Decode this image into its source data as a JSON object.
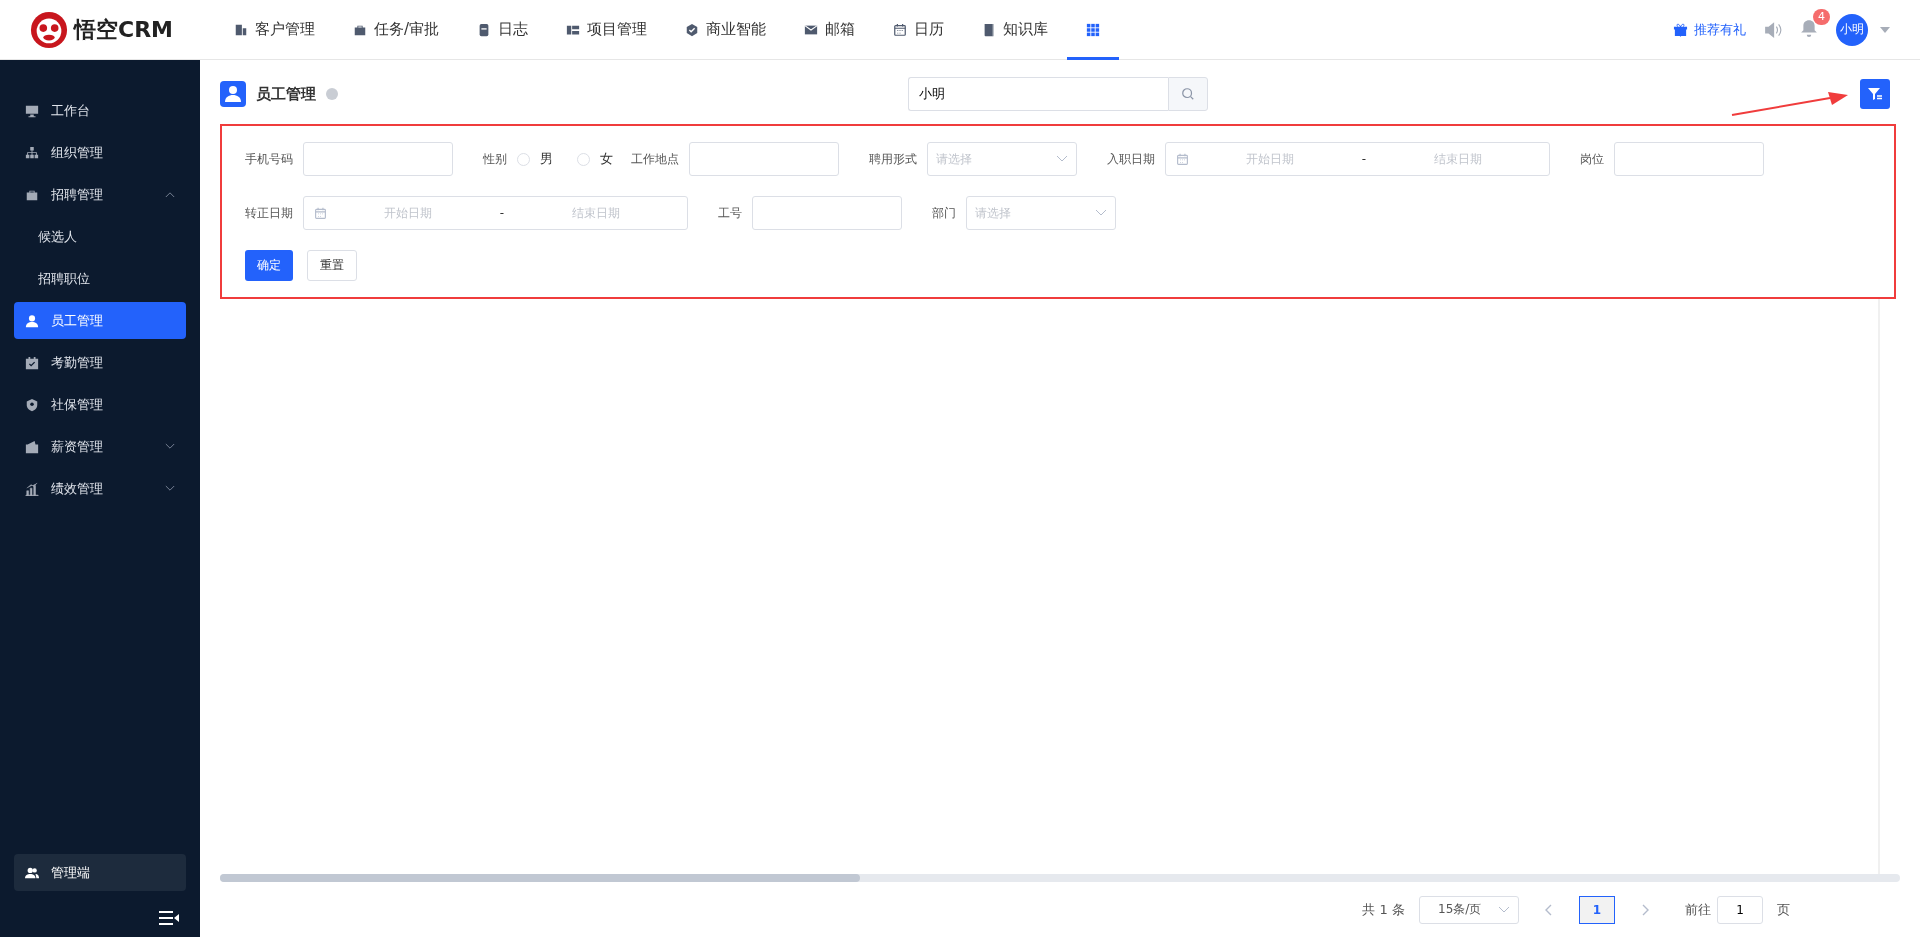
{
  "header": {
    "logo": "悟空CRM",
    "nav": [
      {
        "label": "客户管理",
        "selected": false
      },
      {
        "label": "任务/审批",
        "selected": false
      },
      {
        "label": "日志",
        "selected": false
      },
      {
        "label": "项目管理",
        "selected": false
      },
      {
        "label": "商业智能",
        "selected": false
      },
      {
        "label": "邮箱",
        "selected": false
      },
      {
        "label": "日历",
        "selected": false
      },
      {
        "label": "知识库",
        "selected": false
      },
      {
        "selected": true
      }
    ],
    "gift_link": "推荐有礼",
    "notification_count": "4",
    "user": "小明"
  },
  "sidebar": {
    "items": [
      {
        "label": "工作台",
        "selected": false
      },
      {
        "label": "组织管理",
        "selected": false
      },
      {
        "label": "招聘管理",
        "selected": false,
        "expanded": true,
        "children": [
          {
            "label": "候选人",
            "selected": false
          },
          {
            "label": "招聘职位",
            "selected": false
          }
        ]
      },
      {
        "label": "员工管理",
        "selected": true
      },
      {
        "label": "考勤管理",
        "selected": false
      },
      {
        "label": "社保管理",
        "selected": false
      },
      {
        "label": "薪资管理",
        "selected": false,
        "expanded": false
      },
      {
        "label": "绩效管理",
        "selected": false,
        "expanded": false
      }
    ],
    "admin": "管理端"
  },
  "page": {
    "title": "员工管理",
    "search_value": "小明"
  },
  "filter": {
    "groups": [
      {
        "fields": [
          {
            "kind": "text",
            "label": "手机号码"
          },
          {
            "kind": "radio",
            "label": "性别",
            "options": [
              {
                "label": "男",
                "checked": false
              },
              {
                "label": "女",
                "checked": false
              }
            ]
          },
          {
            "kind": "text",
            "label": "工作地点"
          },
          {
            "kind": "select",
            "label": "聘用形式",
            "placeholder": "请选择"
          },
          {
            "kind": "daterange",
            "label": "入职日期",
            "start": "开始日期",
            "sep": "-",
            "end": "结束日期"
          },
          {
            "kind": "text",
            "label": "岗位"
          }
        ]
      },
      {
        "fields": [
          {
            "kind": "daterange",
            "label": "转正日期",
            "start": "开始日期",
            "sep": "-",
            "end": "结束日期"
          },
          {
            "kind": "text",
            "label": "工号"
          },
          {
            "kind": "select",
            "label": "部门",
            "placeholder": "请选择"
          }
        ]
      }
    ],
    "confirm": "确定",
    "reset": "重置"
  },
  "pagination": {
    "total": "共 1 条",
    "page_size": "15条/页",
    "pages": [
      {
        "label": "1",
        "selected": true
      }
    ],
    "goto_label": "前往",
    "goto_value": "1",
    "goto_suffix": "页"
  }
}
